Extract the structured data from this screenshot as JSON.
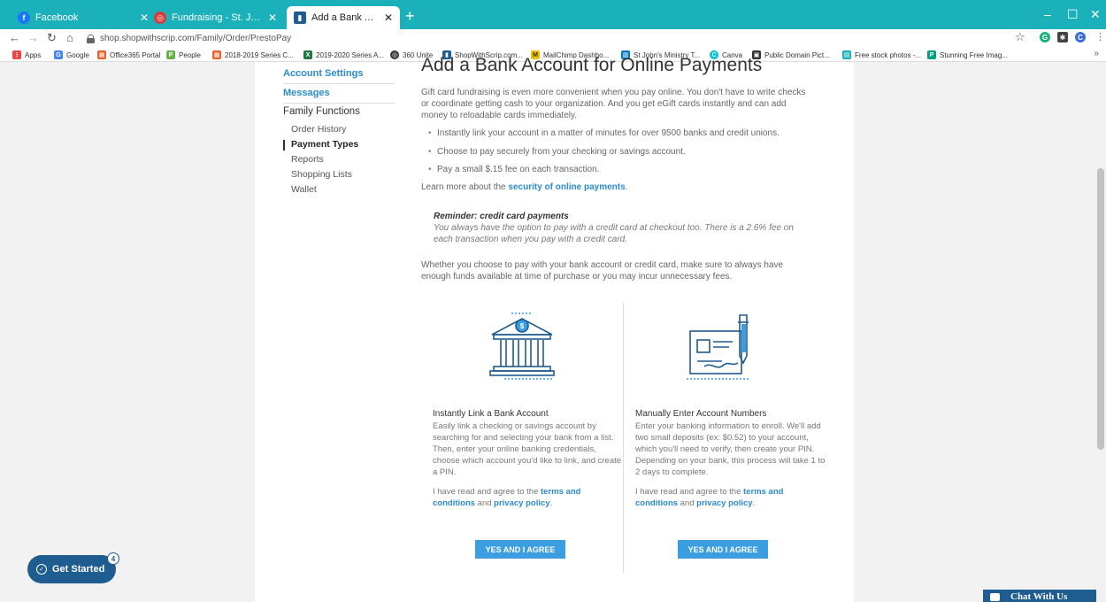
{
  "browser": {
    "tabs": [
      {
        "title": "Facebook",
        "favicon_letter": "f",
        "favicon_color": "#1877f2"
      },
      {
        "title": "Fundraising - St. John's Lutheran",
        "favicon_letter": "◎",
        "favicon_color": "#d93a3a"
      },
      {
        "title": "Add a Bank Account for Online P",
        "favicon_letter": "▮",
        "favicon_color": "#1f5c8f"
      }
    ],
    "new_tab": "+",
    "window_controls": [
      "–",
      "☐",
      "✕"
    ],
    "url": "shop.shopwithscrip.com/Family/Order/PrestoPay",
    "star": "☆",
    "profile_letter": "C",
    "bookmarks": [
      {
        "label": "Apps",
        "icon": "apps-icon",
        "color": "#e44"
      },
      {
        "label": "Google",
        "icon": "google-icon",
        "color": "#4285f4"
      },
      {
        "label": "Office365 Portal",
        "icon": "office-icon",
        "color": "#e95f27"
      },
      {
        "label": "People",
        "icon": "people-icon",
        "color": "#6ab04c"
      },
      {
        "label": "2018-2019 Series C...",
        "icon": "office-icon",
        "color": "#e95f27"
      },
      {
        "label": "2019-2020 Series A...",
        "icon": "excel-icon",
        "color": "#1d7a45"
      },
      {
        "label": "360 Unite",
        "icon": "unite-icon",
        "color": "#333"
      },
      {
        "label": "ShopWithScrip.com...",
        "icon": "scrip-icon",
        "color": "#1f5c8f"
      },
      {
        "label": "MailChimp Dashbo...",
        "icon": "mailchimp-icon",
        "color": "#f0c000"
      },
      {
        "label": "St John's Ministry T...",
        "icon": "trello-icon",
        "color": "#0079bf"
      },
      {
        "label": "Canva",
        "icon": "canva-icon",
        "color": "#00c4cc"
      },
      {
        "label": "Public Domain Pict...",
        "icon": "pdp-icon",
        "color": "#333"
      },
      {
        "label": "Free stock photos -...",
        "icon": "photos-icon",
        "color": "#1bb1ba"
      },
      {
        "label": "Stunning Free Imag...",
        "icon": "pexels-icon",
        "color": "#05a081"
      }
    ],
    "bookmarks_more": "»"
  },
  "sidebar": {
    "account_settings": "Account Settings",
    "messages": "Messages",
    "family_functions": "Family Functions",
    "items": [
      {
        "label": "Order History"
      },
      {
        "label": "Payment Types"
      },
      {
        "label": "Reports"
      },
      {
        "label": "Shopping Lists"
      },
      {
        "label": "Wallet"
      }
    ]
  },
  "main": {
    "title": "Add a Bank Account for Online Payments",
    "intro": "Gift card fundraising is even more convenient when you pay online. You don't have to write checks or coordinate getting cash to your organization. And you get eGift cards instantly and can add money to reloadable cards immediately.",
    "bullets": [
      "Instantly link your account in a matter of minutes for over 9500 banks and credit unions.",
      "Choose to pay securely from your checking or savings account.",
      "Pay a small $.15 fee on each transaction."
    ],
    "learn_more_prefix": "Learn more about the ",
    "learn_more_link": "security of online payments",
    "learn_more_suffix": ".",
    "reminder_title": "Reminder: credit card payments",
    "reminder_text": "You always have the option to pay with a credit card at checkout too. There is a 2.6% fee on each transaction when you pay with a credit card.",
    "whether_text": "Whether you choose to pay with your bank account or credit card, make sure to always have enough funds available at time of purchase or you may incur unnecessary fees.",
    "options": [
      {
        "title": "Instantly Link a Bank Account",
        "text": "Easily link a checking or savings account by searching for and selecting your bank from a list. Then, enter your online banking credentials, choose which account you'd like to link, and create a PIN.",
        "agree_prefix": "I have read and agree to the ",
        "terms_link": "terms and conditions",
        "agree_mid": " and ",
        "privacy_link": "privacy policy",
        "agree_suffix": ".",
        "button": "YES AND I AGREE"
      },
      {
        "title": "Manually Enter Account Numbers",
        "text": "Enter your banking information to enroll. We'll add two small deposits (ex: $0.52) to your account, which you'll need to verify, then create your PIN. Depending on your bank, this process will take 1 to 2 days to complete.",
        "agree_prefix": "I have read and agree to the ",
        "terms_link": "terms and conditions",
        "agree_mid": " and ",
        "privacy_link": "privacy policy",
        "agree_suffix": ".",
        "button": "YES AND I AGREE"
      }
    ]
  },
  "widgets": {
    "get_started": "Get Started",
    "get_started_badge": "4",
    "chat": "Chat With Us"
  },
  "colors": {
    "chrome_accent": "#1bb1ba",
    "link": "#2b8ad0",
    "button": "#3a9ee0",
    "brand_dark": "#1f5c8f"
  }
}
